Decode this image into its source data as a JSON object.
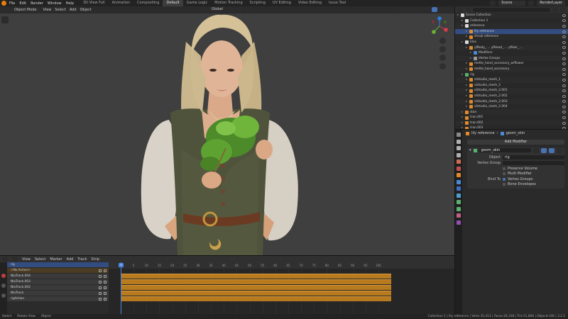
{
  "topbar": {
    "menu": [
      "File",
      "Edit",
      "Render",
      "Window",
      "Help"
    ],
    "workspaces": [
      {
        "label": "3D View Full",
        "active": false
      },
      {
        "label": "Animation",
        "active": false
      },
      {
        "label": "Compositing",
        "active": false
      },
      {
        "label": "Default",
        "active": true
      },
      {
        "label": "Game Logic",
        "active": false
      },
      {
        "label": "Motion Tracking",
        "active": false
      },
      {
        "label": "Scripting",
        "active": false
      },
      {
        "label": "UV Editing",
        "active": false
      },
      {
        "label": "Video Editing",
        "active": false
      },
      {
        "label": "Issue Tool",
        "active": false
      }
    ],
    "scene": "Scene",
    "view_layer": "RenderLayer"
  },
  "viewport": {
    "mode": "Object Mode",
    "menu": [
      "View",
      "Select",
      "Add",
      "Object"
    ],
    "orientation": "Global"
  },
  "outliner": {
    "rows": [
      {
        "label": "Scene Collection",
        "depth": 0,
        "icon": "collection",
        "sel": false
      },
      {
        "label": "Collection 1",
        "depth": 1,
        "icon": "collection",
        "sel": false
      },
      {
        "label": "reference",
        "depth": 1,
        "icon": "collection",
        "sel": false
      },
      {
        "label": "lily reference",
        "depth": 2,
        "icon": "mesh",
        "sel": true
      },
      {
        "label": "shrub reference",
        "depth": 2,
        "icon": "mesh",
        "sel": false
      },
      {
        "label": "Elsa",
        "depth": 1,
        "icon": "collection",
        "sel": false
      },
      {
        "label": "yfBody_ ... yfHead_ ... yfHair_ ...",
        "depth": 2,
        "icon": "mesh",
        "sel": false
      },
      {
        "label": "Modifiers",
        "depth": 3,
        "icon": "wrench",
        "sel": false
      },
      {
        "label": "Vertex Groups",
        "depth": 3,
        "icon": "vgroup",
        "sel": false
      },
      {
        "label": "mette_hand_accessory_w/flower",
        "depth": 2,
        "icon": "mesh",
        "sel": false
      },
      {
        "label": "mette_hand_accessory",
        "depth": 2,
        "icon": "mesh",
        "sel": false
      },
      {
        "label": "rig",
        "depth": 1,
        "icon": "armature",
        "sel": false
      },
      {
        "label": "s4studio_mesh_1",
        "depth": 2,
        "icon": "mesh",
        "sel": false
      },
      {
        "label": "s4studio_mesh_2",
        "depth": 2,
        "icon": "mesh",
        "sel": false
      },
      {
        "label": "s4studio_mesh_2.001",
        "depth": 2,
        "icon": "mesh",
        "sel": false
      },
      {
        "label": "s4studio_mesh_2.002",
        "depth": 2,
        "icon": "mesh",
        "sel": false
      },
      {
        "label": "s4studio_mesh_2.003",
        "depth": 2,
        "icon": "mesh",
        "sel": false
      },
      {
        "label": "s4studio_mesh_2.004",
        "depth": 2,
        "icon": "mesh",
        "sel": false
      },
      {
        "label": "stan",
        "depth": 1,
        "icon": "mesh",
        "sel": false
      },
      {
        "label": "tran.001",
        "depth": 1,
        "icon": "mesh",
        "sel": false
      },
      {
        "label": "tran.002",
        "depth": 1,
        "icon": "mesh",
        "sel": false
      },
      {
        "label": "tran.003",
        "depth": 1,
        "icon": "mesh",
        "sel": false
      }
    ]
  },
  "properties": {
    "breadcrumb_object": "lily reference",
    "breadcrumb_modifier": "geom_skin",
    "add_modifier": "Add Modifier",
    "modifier_name": "geom_skin",
    "object_label": "Object",
    "object_value": "rig",
    "vertex_group_label": "Vertex Group",
    "vertex_group_value": "",
    "preserve_volume": "Preserve Volume",
    "multi_modifier": "Multi Modifier",
    "bind_to_label": "Bind To",
    "vertex_groups": "Vertex Groups",
    "bone_envelopes": "Bone Envelopes"
  },
  "nla": {
    "menu": [
      "View",
      "Select",
      "Marker",
      "Add",
      "Track",
      "Strip"
    ],
    "tracks": [
      {
        "label": "rig",
        "kind": "object"
      },
      {
        "label": "<No Action>",
        "kind": "action"
      },
      {
        "label": "NlaTrack.004",
        "kind": "track"
      },
      {
        "label": "NlaTrack.003",
        "kind": "track"
      },
      {
        "label": "NlaTrack.002",
        "kind": "track"
      },
      {
        "label": "NlaTrack",
        "kind": "track"
      },
      {
        "label": "rigAction",
        "kind": "track"
      }
    ],
    "current_frame": "0",
    "ticks": [
      0,
      5,
      10,
      15,
      20,
      25,
      30,
      35,
      40,
      45,
      50,
      55,
      60,
      65,
      70,
      75,
      80,
      85,
      90,
      95,
      100
    ],
    "frame_end": 100
  },
  "statusbar": {
    "items": [
      "Select",
      "Rotate View",
      "Object"
    ],
    "stats": "Collection 1 | lily reference | Verts:35,413 | Faces:26,338 | Tris:51,806 | Objects:0/6 | 3.2.2"
  },
  "colors": {
    "accent": "#4772b3",
    "strip": "#b87a1e",
    "blender_orange": "#e87d0d"
  }
}
